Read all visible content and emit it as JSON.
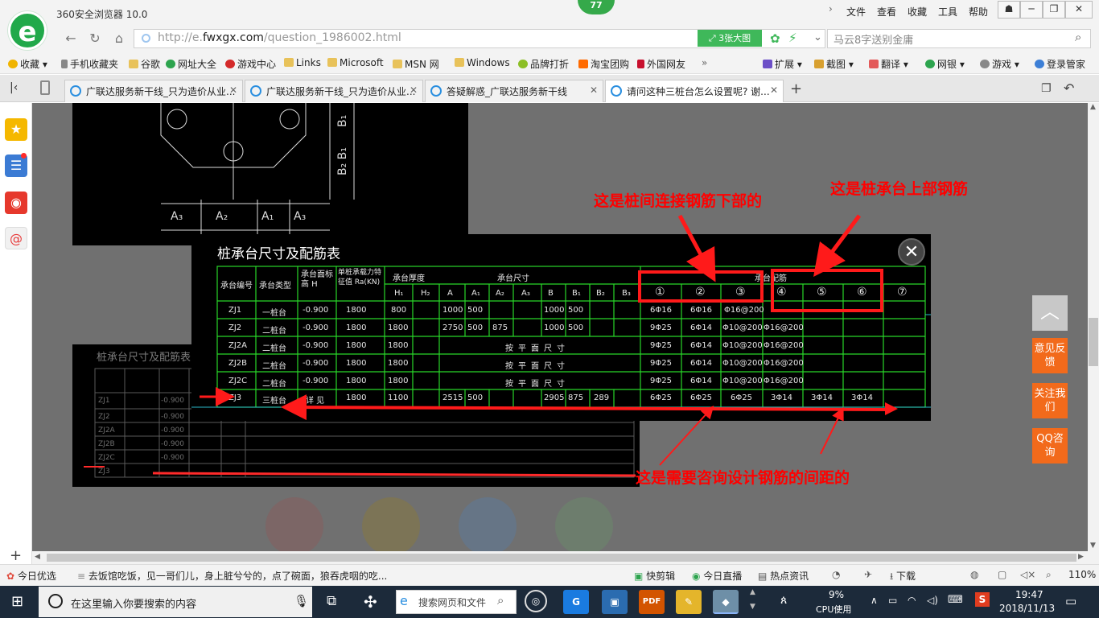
{
  "browser": {
    "title": "360安全浏览器 10.0",
    "badge": "77",
    "menu": [
      "文件",
      "查看",
      "收藏",
      "工具",
      "帮助"
    ],
    "url_prefix": "http://e.",
    "url_domain": "fwxgx.com",
    "url_path": "/question_1986002.html",
    "big_image_label": "3张大图",
    "search_placeholder": "马云8字送别金庸"
  },
  "bookmarks": {
    "items": [
      "收藏",
      "手机收藏夹",
      "谷歌",
      "网址大全",
      "游戏中心",
      "Links",
      "Microsoft",
      "MSN 网",
      "Windows",
      "品牌打折",
      "淘宝团购",
      "外国网友"
    ],
    "more": "»",
    "tools": [
      "扩展",
      "截图",
      "翻译",
      "网银",
      "游戏",
      "登录管家"
    ]
  },
  "tabs": [
    {
      "label": "广联达服务新干线_只为造价从业..."
    },
    {
      "label": "广联达服务新干线_只为造价从业..."
    },
    {
      "label": "答疑解惑_广联达服务新干线"
    },
    {
      "label": "请问这种三桩台怎么设置呢? 谢..."
    }
  ],
  "page": {
    "annotations": {
      "lower_rebar": "这是桩间连接钢筋下部的",
      "upper_rebar": "这是桩承台上部钢筋",
      "spacing_question": "这是需要咨询设计钢筋的间距的"
    },
    "table_title": "桩承台尺寸及配筋表",
    "table_header": {
      "id": "承台编号",
      "type": "承台类型",
      "elevation": "承台面标高 H",
      "capacity": "单桩承载力特征值 Ra(KN)",
      "thickness": "承台厚度",
      "size": "承台尺寸",
      "rebar": "承台配筋",
      "sub": [
        "H₁",
        "H₂",
        "A",
        "A₁",
        "A₂",
        "A₃",
        "B",
        "B₁",
        "B₂",
        "B₃",
        "①",
        "②",
        "③",
        "④",
        "⑤",
        "⑥",
        "⑦"
      ]
    },
    "rows": [
      {
        "id": "ZJ1",
        "type": "一桩台",
        "h": "-0.900",
        "ra": "1800",
        "h1": "800",
        "a": "1000",
        "a1": "500",
        "b": "1000",
        "b1": "500",
        "r1": "6Φ16",
        "r2": "6Φ16",
        "r3": "Φ16@200"
      },
      {
        "id": "ZJ2",
        "type": "二桩台",
        "h": "-0.900",
        "ra": "1800",
        "h1": "1800",
        "a": "2750",
        "a1": "500",
        "a2": "875",
        "b": "1000",
        "b1": "500",
        "r1": "9Φ25",
        "r2": "6Φ14",
        "r3": "Φ10@200",
        "r4": "Φ16@200"
      },
      {
        "id": "ZJ2A",
        "type": "二桩台",
        "h": "-0.900",
        "ra": "1800",
        "h1": "1800",
        "size": "按平面尺寸",
        "r1": "9Φ25",
        "r2": "6Φ14",
        "r3": "Φ10@200",
        "r4": "Φ16@200"
      },
      {
        "id": "ZJ2B",
        "type": "二桩台",
        "h": "-0.900",
        "ra": "1800",
        "h1": "1800",
        "size": "按平面尺寸",
        "r1": "9Φ25",
        "r2": "6Φ14",
        "r3": "Φ10@200",
        "r4": "Φ16@200"
      },
      {
        "id": "ZJ2C",
        "type": "二桩台",
        "h": "-0.900",
        "ra": "1800",
        "h1": "1800",
        "size": "按平面尺寸",
        "r1": "9Φ25",
        "r2": "6Φ14",
        "r3": "Φ10@200",
        "r4": "Φ16@200"
      },
      {
        "id": "ZJ3",
        "type": "三桩台",
        "h": "详 见",
        "ra": "1800",
        "h1": "1100",
        "a": "2515",
        "a1": "500",
        "b": "2905",
        "b1": "875",
        "b2": "289",
        "r1": "6Φ25",
        "r2": "6Φ25",
        "r3": "6Φ25",
        "r4": "3Φ14",
        "r5": "3Φ14",
        "r6": "3Φ14"
      }
    ],
    "side_buttons": [
      "意见反馈",
      "关注我们",
      "QQ咨询"
    ]
  },
  "statusbar": {
    "left": "今日优选",
    "news": "去饭馆吃饭，见一哥们儿，身上脏兮兮的，点了碗面，狼吞虎咽的吃...",
    "items": [
      "快剪辑",
      "今日直播",
      "热点资讯",
      "下载"
    ],
    "zoom": "110%"
  },
  "taskbar": {
    "search_text": "在这里输入你要搜索的内容",
    "browser_search": "搜索网页和文件",
    "cpu_percent": "9%",
    "cpu_label": "CPU使用",
    "time": "19:47",
    "date": "2018/11/13"
  }
}
